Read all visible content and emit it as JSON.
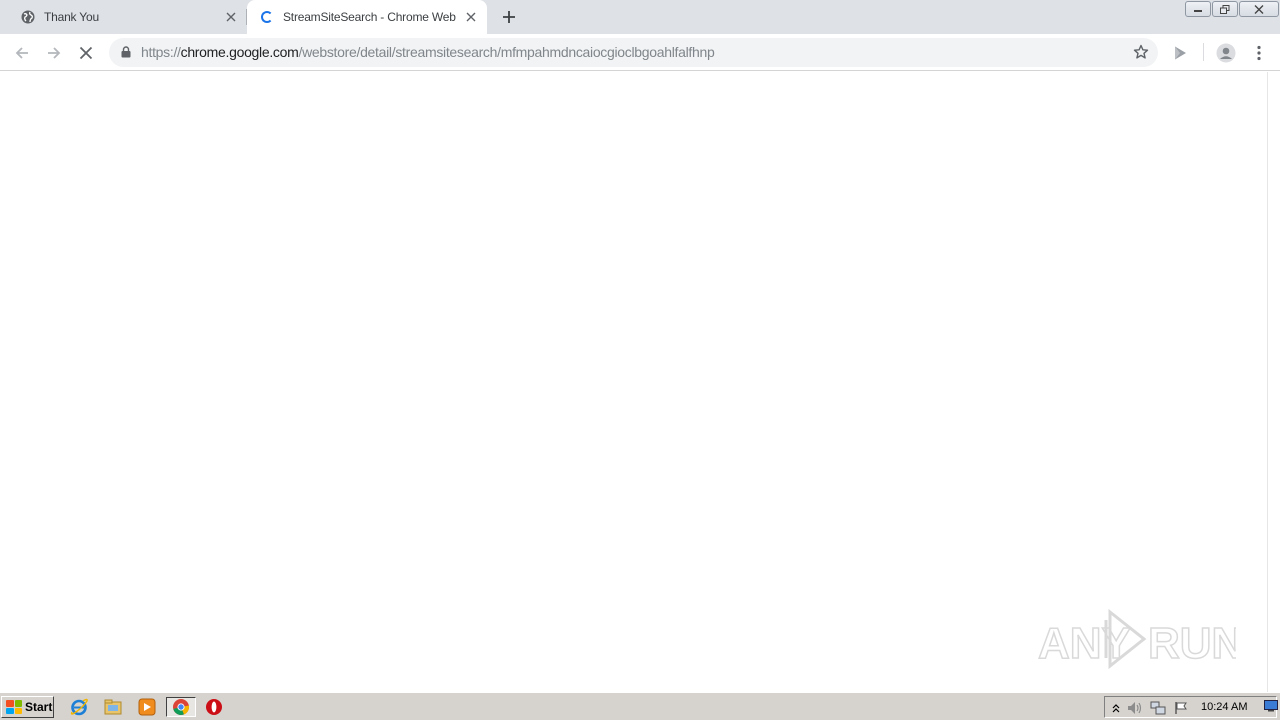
{
  "browser": {
    "tabs": [
      {
        "title": "Thank You",
        "favicon": "globe-icon",
        "active": false
      },
      {
        "title": "StreamSiteSearch - Chrome Web Sto",
        "favicon": "loading-spinner",
        "active": true
      }
    ],
    "new_tab_icon": "plus-icon",
    "address_bar": {
      "scheme": "https://",
      "host": "chrome.google.com",
      "path": "/webstore/detail/streamsitesearch/mfmpahmdncaiocgioclbgoahlfalfhnp"
    },
    "toolbar_icons": [
      "back-arrow-icon",
      "forward-arrow-icon",
      "stop-loading-icon",
      "lock-icon",
      "star-icon",
      "extension-play-icon",
      "profile-avatar-icon",
      "menu-kebab-icon"
    ]
  },
  "watermark": {
    "text_left": "ANY",
    "text_right": "RUN"
  },
  "taskbar": {
    "start_label": "Start",
    "pinned": [
      "internet-explorer-icon",
      "file-explorer-icon",
      "media-player-icon",
      "chrome-icon",
      "opera-icon"
    ],
    "tray_icons": [
      "show-hidden-icons-arrow",
      "volume-icon",
      "network-icon",
      "action-center-flag-icon"
    ],
    "clock": "10:24 AM",
    "colors": {
      "taskbar": "#d6d3ce",
      "tabstrip": "#dee1e6",
      "spinner": "#1a73e8"
    }
  }
}
